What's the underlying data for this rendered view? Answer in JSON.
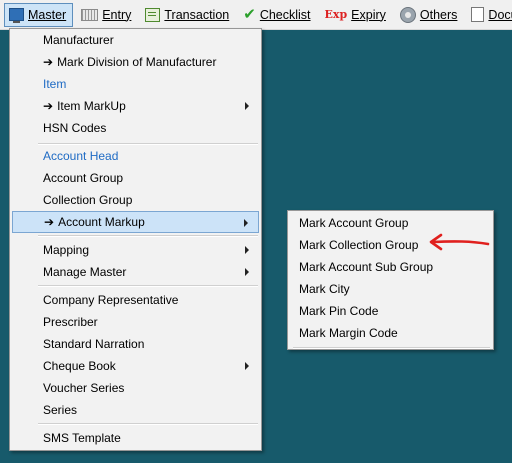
{
  "menubar": {
    "items": [
      {
        "label": "Master",
        "icon": "master-icon",
        "active": true
      },
      {
        "label": "Entry",
        "icon": "keyboard-icon"
      },
      {
        "label": "Transaction",
        "icon": "transaction-icon"
      },
      {
        "label": "Checklist",
        "icon": "checkmark-icon"
      },
      {
        "label": "Expiry",
        "icon": "expiry-icon",
        "icon_text": "Exp"
      },
      {
        "label": "Others",
        "icon": "others-icon"
      },
      {
        "label": "Docum",
        "icon": "document-icon"
      }
    ]
  },
  "master_menu": {
    "items": [
      {
        "label": "Manufacturer"
      },
      {
        "arrow": "➔",
        "label": "Mark Division of Manufacturer"
      },
      {
        "label": "Item"
      },
      {
        "arrow": "➔",
        "label": "Item MarkUp"
      },
      {
        "label": "HSN Codes"
      },
      {
        "label": "Account Head"
      },
      {
        "label": "Account Group"
      },
      {
        "label": "Collection Group"
      },
      {
        "arrow": "➔",
        "label": "Account Markup"
      },
      {
        "label": "Mapping"
      },
      {
        "label": "Manage Master"
      },
      {
        "label": "Company Representative"
      },
      {
        "label": "Prescriber"
      },
      {
        "label": "Standard Narration"
      },
      {
        "label": "Cheque Book"
      },
      {
        "label": "Voucher Series"
      },
      {
        "label": "Series"
      },
      {
        "label": "SMS Template"
      }
    ]
  },
  "account_markup_submenu": {
    "items": [
      {
        "label": "Mark Account Group"
      },
      {
        "label": "Mark Collection Group"
      },
      {
        "label": "Mark Account Sub Group"
      },
      {
        "label": "Mark City"
      },
      {
        "label": "Mark Pin Code"
      },
      {
        "label": "Mark Margin Code"
      }
    ]
  },
  "colors": {
    "desktop_background": "#175a6b",
    "menu_background": "#f2f2f2",
    "highlight": "#cce3f8",
    "link_text": "#1f6bc4",
    "annotation_arrow": "#e0201e"
  }
}
